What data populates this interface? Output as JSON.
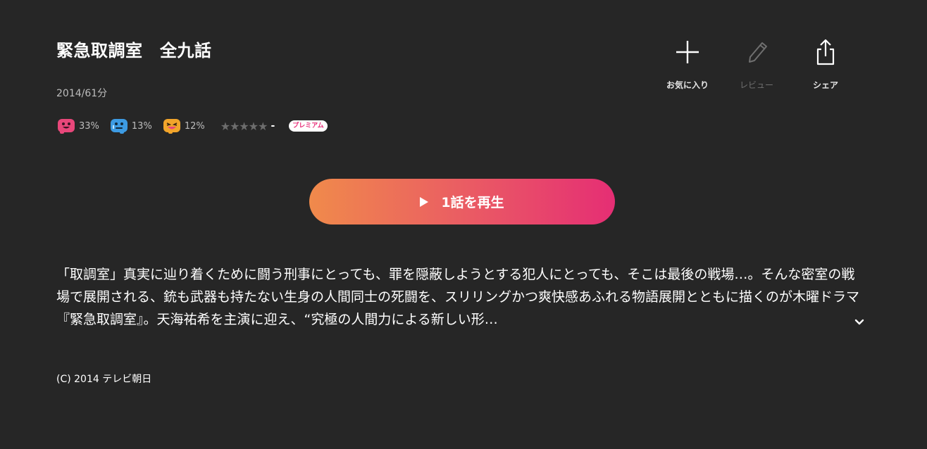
{
  "title": "緊急取調室　全九話",
  "meta": "2014/61分",
  "emotions": [
    {
      "icon": "happy-face-icon",
      "color": "#e8477a",
      "percent": "33%"
    },
    {
      "icon": "sad-face-icon",
      "color": "#3d9be3",
      "percent": "13%"
    },
    {
      "icon": "excited-face-icon",
      "color": "#f2a52b",
      "percent": "12%"
    }
  ],
  "rating": {
    "stars": 0,
    "value": "-"
  },
  "badge": "プレミアム",
  "actions": {
    "favorite": "お気に入り",
    "review": "レビュー",
    "share": "シェア"
  },
  "play_button": "1話を再生",
  "description": "「取調室」真実に辿り着くために闘う刑事にとっても、罪を隠蔽しようとする犯人にとっても、そこは最後の戦場…。そんな密室の戦場で展開される、銃も武器も持たない生身の人間同士の死闘を、スリリングかつ爽快感あふれる物語展開とともに描くのが木曜ドラマ『緊急取調室』。天海祐希を主演に迎え、“究極の人間力による新しい形…",
  "copyright": "(C) 2014 テレビ朝日",
  "colors": {
    "background": "#262626",
    "gradient_start": "#f08a4b",
    "gradient_end": "#e52e74",
    "badge_text": "#e8307a"
  }
}
